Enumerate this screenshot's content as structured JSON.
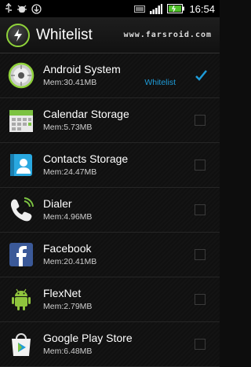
{
  "status_bar": {
    "time": "16:54",
    "icons": [
      "usb-icon",
      "debug-icon",
      "download-icon",
      "notification-icon",
      "signal-icon",
      "battery-icon"
    ]
  },
  "title_bar": {
    "title": "Whitelist",
    "site": "www.farsroid.com"
  },
  "apps": [
    {
      "name": "Android System",
      "mem": "Mem:30.41MB",
      "whitelist_label": "Whitelist",
      "checked": true
    },
    {
      "name": "Calendar Storage",
      "mem": "Mem:5.73MB",
      "checked": false
    },
    {
      "name": "Contacts Storage",
      "mem": "Mem:24.47MB",
      "checked": false
    },
    {
      "name": "Dialer",
      "mem": "Mem:4.96MB",
      "checked": false
    },
    {
      "name": "Facebook",
      "mem": "Mem:20.41MB",
      "checked": false
    },
    {
      "name": "FlexNet",
      "mem": "Mem:2.79MB",
      "checked": false
    },
    {
      "name": "Google Play Store",
      "mem": "Mem:6.48MB",
      "checked": false
    }
  ],
  "colors": {
    "accent": "#1e9bd7",
    "logo_ring": "#8fd23a"
  }
}
